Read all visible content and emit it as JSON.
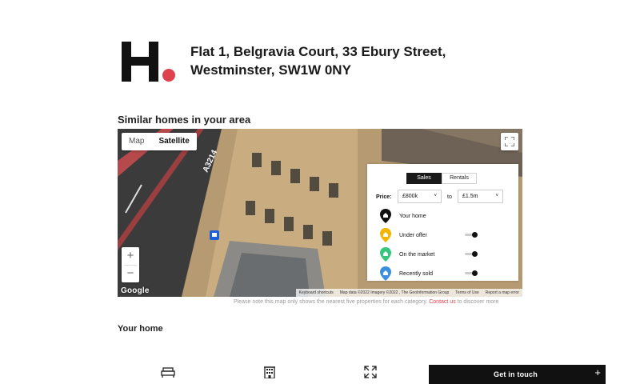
{
  "brand": {
    "logo_letter": "H",
    "accent": "#e0414f"
  },
  "property": {
    "address": "Flat 1, Belgravia Court, 33 Ebury Street, Westminster, SW1W 0NY"
  },
  "similar": {
    "title": "Similar homes in your area"
  },
  "map": {
    "type_options": [
      "Map",
      "Satellite"
    ],
    "type_selected": "Satellite",
    "road_label": "A3214",
    "google_text": "Google",
    "attribution": [
      "Keyboard shortcuts",
      "Map data ©2022 Imagery ©2022 , The GeoInformation Group",
      "Terms of Use",
      "Report a map error"
    ],
    "zoom_in": "+",
    "zoom_out": "−"
  },
  "filter": {
    "tabs": [
      "Sales",
      "Rentals"
    ],
    "active_tab": "Sales",
    "price_label": "Price:",
    "price_min": "£800k",
    "to_label": "to",
    "price_max": "£1.5m",
    "legend": [
      {
        "label": "Your home",
        "color": "#111111",
        "toggle": false
      },
      {
        "label": "Under offer",
        "color": "#f4b400",
        "toggle": true,
        "on": true
      },
      {
        "label": "On the market",
        "color": "#34c77b",
        "toggle": true,
        "on": true
      },
      {
        "label": "Recently sold",
        "color": "#3b8de0",
        "toggle": true,
        "on": true
      }
    ]
  },
  "note": {
    "text": "Please note this map only shows the nearest five properties for each category.",
    "link": "Contact us",
    "suffix": " to discover more"
  },
  "your_home": {
    "title": "Your home",
    "features": [
      "bed-icon",
      "building-icon",
      "expand-icon"
    ]
  },
  "cta": {
    "label": "Get in touch",
    "plus": "+"
  }
}
